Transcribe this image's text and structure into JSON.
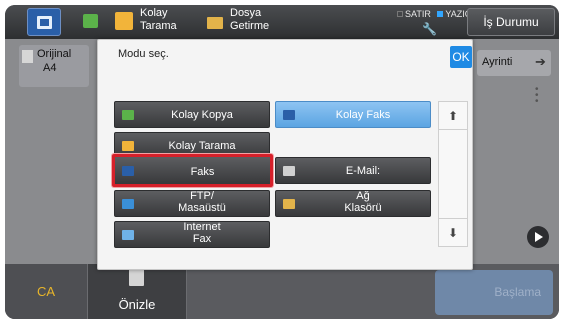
{
  "topbar": {
    "kolay_tarama_label": "Kolay\nTarama",
    "dosya_getirme_label": "Dosya\nGetirme",
    "status_satir": "SATIR",
    "status_yazici": "YAZICI",
    "is_durumu_label": "İş Durumu"
  },
  "background": {
    "original_label": "Orijinal",
    "original_value": "A4",
    "ayrinti_label": "Ayrinti"
  },
  "modal": {
    "title": "Modu seç.",
    "ok_label": "OK",
    "modes": [
      {
        "label": "Kolay Kopya",
        "icon": "copy-icon",
        "icon_color": "#5bb24a"
      },
      {
        "label": "Kolay Faks",
        "icon": "fax-icon",
        "icon_color": "#2a5fa8",
        "state": "active"
      },
      {
        "label": "Kolay Tarama",
        "icon": "scan-icon",
        "icon_color": "#f2b43a"
      },
      {
        "label": "Faks",
        "icon": "fax-icon",
        "icon_color": "#2a5fa8",
        "state": "selected"
      },
      {
        "label": "E-Mail:",
        "icon": "email-icon",
        "icon_color": "#d0d0d0"
      },
      {
        "label": "FTP/\nMasaüstü",
        "icon": "ftp-icon",
        "icon_color": "#3a8fd8"
      },
      {
        "label": "Ağ\nKlasörü",
        "icon": "folder-icon",
        "icon_color": "#e2b34a"
      },
      {
        "label": "Internet\nFax",
        "icon": "internet-fax-icon",
        "icon_color": "#6fb2e8"
      }
    ],
    "scroll_up_icon": "chevron-up-icon",
    "scroll_down_icon": "chevron-down-icon"
  },
  "bottombar": {
    "ca_label": "CA",
    "onizle_label": "Önizle",
    "baslama_label": "Başlama"
  },
  "colors": {
    "accent_blue": "#1e8ae4",
    "ca_yellow": "#e8b52a",
    "selection_red": "#d6202a",
    "active_mode_blue": "#5ba4e2"
  }
}
